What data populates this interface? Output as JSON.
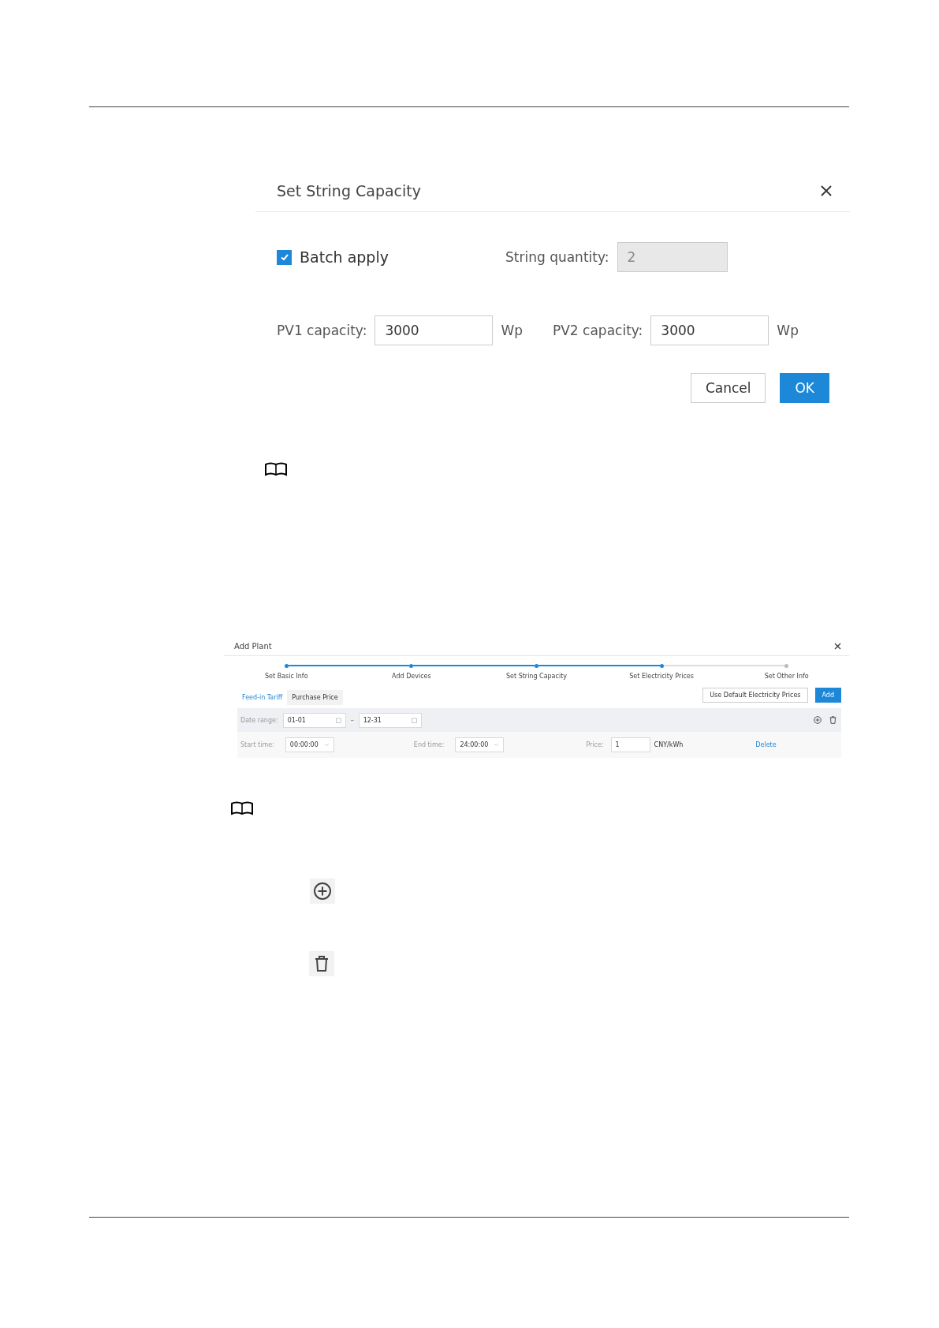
{
  "string_dialog": {
    "title": "Set String Capacity",
    "batch_apply": {
      "label": "Batch apply",
      "checked": true
    },
    "string_quantity": {
      "label": "String quantity:",
      "value": "2",
      "disabled": true
    },
    "capacities": [
      {
        "label": "PV1 capacity:",
        "value": "3000",
        "unit": "Wp"
      },
      {
        "label": "PV2 capacity:",
        "value": "3000",
        "unit": "Wp"
      }
    ],
    "buttons": [
      {
        "label": "Cancel",
        "kind": "secondary"
      },
      {
        "label": "OK",
        "kind": "primary"
      }
    ]
  },
  "add_plant_dialog": {
    "title": "Add Plant",
    "steps": [
      {
        "label": "Set Basic Info",
        "done": true
      },
      {
        "label": "Add Devices",
        "done": true
      },
      {
        "label": "Set String Capacity",
        "done": true
      },
      {
        "label": "Set Electricity Prices",
        "done": true
      },
      {
        "label": "Set Other Info",
        "done": false
      }
    ],
    "tabs": [
      {
        "label": "Feed-in Tariff",
        "selected": true
      },
      {
        "label": "Purchase Price",
        "selected": false
      }
    ],
    "buttons": [
      {
        "label": "Use Default Electricity Prices",
        "kind": "secondary"
      },
      {
        "label": "Add",
        "kind": "primary"
      }
    ],
    "date_range": {
      "label": "Date range:",
      "start": "01-01",
      "separator": "–",
      "end": "12-31"
    },
    "time_row": {
      "start_label": "Start time:",
      "start": "00:00:00",
      "end_label": "End time:",
      "end": "24:00:00",
      "price_label": "Price:",
      "price": "1",
      "unit": "CNY/kWh",
      "delete": "Delete"
    }
  }
}
